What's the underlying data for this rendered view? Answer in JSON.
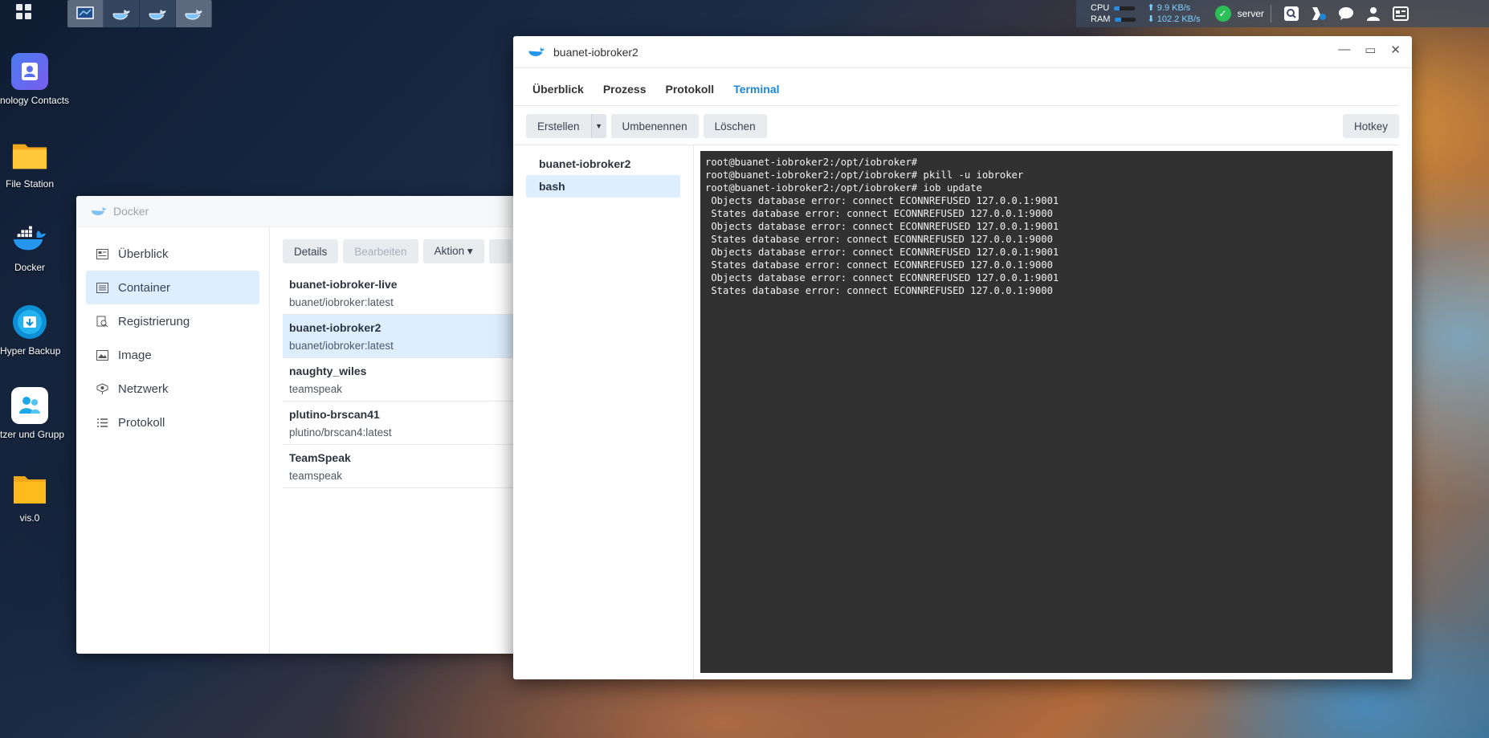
{
  "taskbar": {
    "cpu_label": "CPU",
    "ram_label": "RAM",
    "cpu_level": 0.25,
    "ram_level": 0.3,
    "upload": "9.9 KB/s",
    "download": "102.2 KB/s",
    "server_name": "server",
    "upload_arrow": "⬆",
    "download_arrow": "⬇"
  },
  "desktop": {
    "icons": [
      {
        "label": "nology Contacts",
        "icon": "contacts-icon"
      },
      {
        "label": "File Station",
        "icon": "folder-icon"
      },
      {
        "label": "Docker",
        "icon": "docker-icon"
      },
      {
        "label": "Hyper Backup",
        "icon": "backup-icon"
      },
      {
        "label": "tzer und Grupp",
        "icon": "users-icon"
      },
      {
        "label": "vis.0",
        "icon": "folder-icon"
      }
    ]
  },
  "docker": {
    "title": "Docker",
    "nav": [
      {
        "label": "Überblick",
        "icon": "overview-icon"
      },
      {
        "label": "Container",
        "icon": "container-icon"
      },
      {
        "label": "Registrierung",
        "icon": "registry-icon"
      },
      {
        "label": "Image",
        "icon": "image-icon"
      },
      {
        "label": "Netzwerk",
        "icon": "network-icon"
      },
      {
        "label": "Protokoll",
        "icon": "log-icon"
      }
    ],
    "toolbar": {
      "details": "Details",
      "edit": "Bearbeiten",
      "action": "Aktion ▾"
    },
    "containers": [
      {
        "name": "buanet-iobroker-live",
        "image": "buanet/iobroker:latest"
      },
      {
        "name": "buanet-iobroker2",
        "image": "buanet/iobroker:latest"
      },
      {
        "name": "naughty_wiles",
        "image": "teamspeak"
      },
      {
        "name": "plutino-brscan41",
        "image": "plutino/brscan4:latest"
      },
      {
        "name": "TeamSpeak",
        "image": "teamspeak"
      }
    ]
  },
  "container_window": {
    "title": "buanet-iobroker2",
    "tabs": [
      "Überblick",
      "Prozess",
      "Protokoll",
      "Terminal"
    ],
    "toolbar": {
      "create": "Erstellen",
      "rename": "Umbenennen",
      "delete": "Löschen",
      "hotkey": "Hotkey"
    },
    "sessions": [
      "buanet-iobroker2",
      "bash"
    ],
    "terminal_lines": [
      "root@buanet-iobroker2:/opt/iobroker#",
      "root@buanet-iobroker2:/opt/iobroker# pkill -u iobroker",
      "root@buanet-iobroker2:/opt/iobroker# iob update",
      " Objects database error: connect ECONNREFUSED 127.0.0.1:9001",
      " States database error: connect ECONNREFUSED 127.0.0.1:9000",
      " Objects database error: connect ECONNREFUSED 127.0.0.1:9001",
      " States database error: connect ECONNREFUSED 127.0.0.1:9000",
      " Objects database error: connect ECONNREFUSED 127.0.0.1:9001",
      " States database error: connect ECONNREFUSED 127.0.0.1:9000",
      " Objects database error: connect ECONNREFUSED 127.0.0.1:9001",
      " States database error: connect ECONNREFUSED 127.0.0.1:9000"
    ]
  },
  "colors": {
    "accent": "#1e86d8",
    "selection": "#ddeefe",
    "terminal_bg": "#313131"
  }
}
